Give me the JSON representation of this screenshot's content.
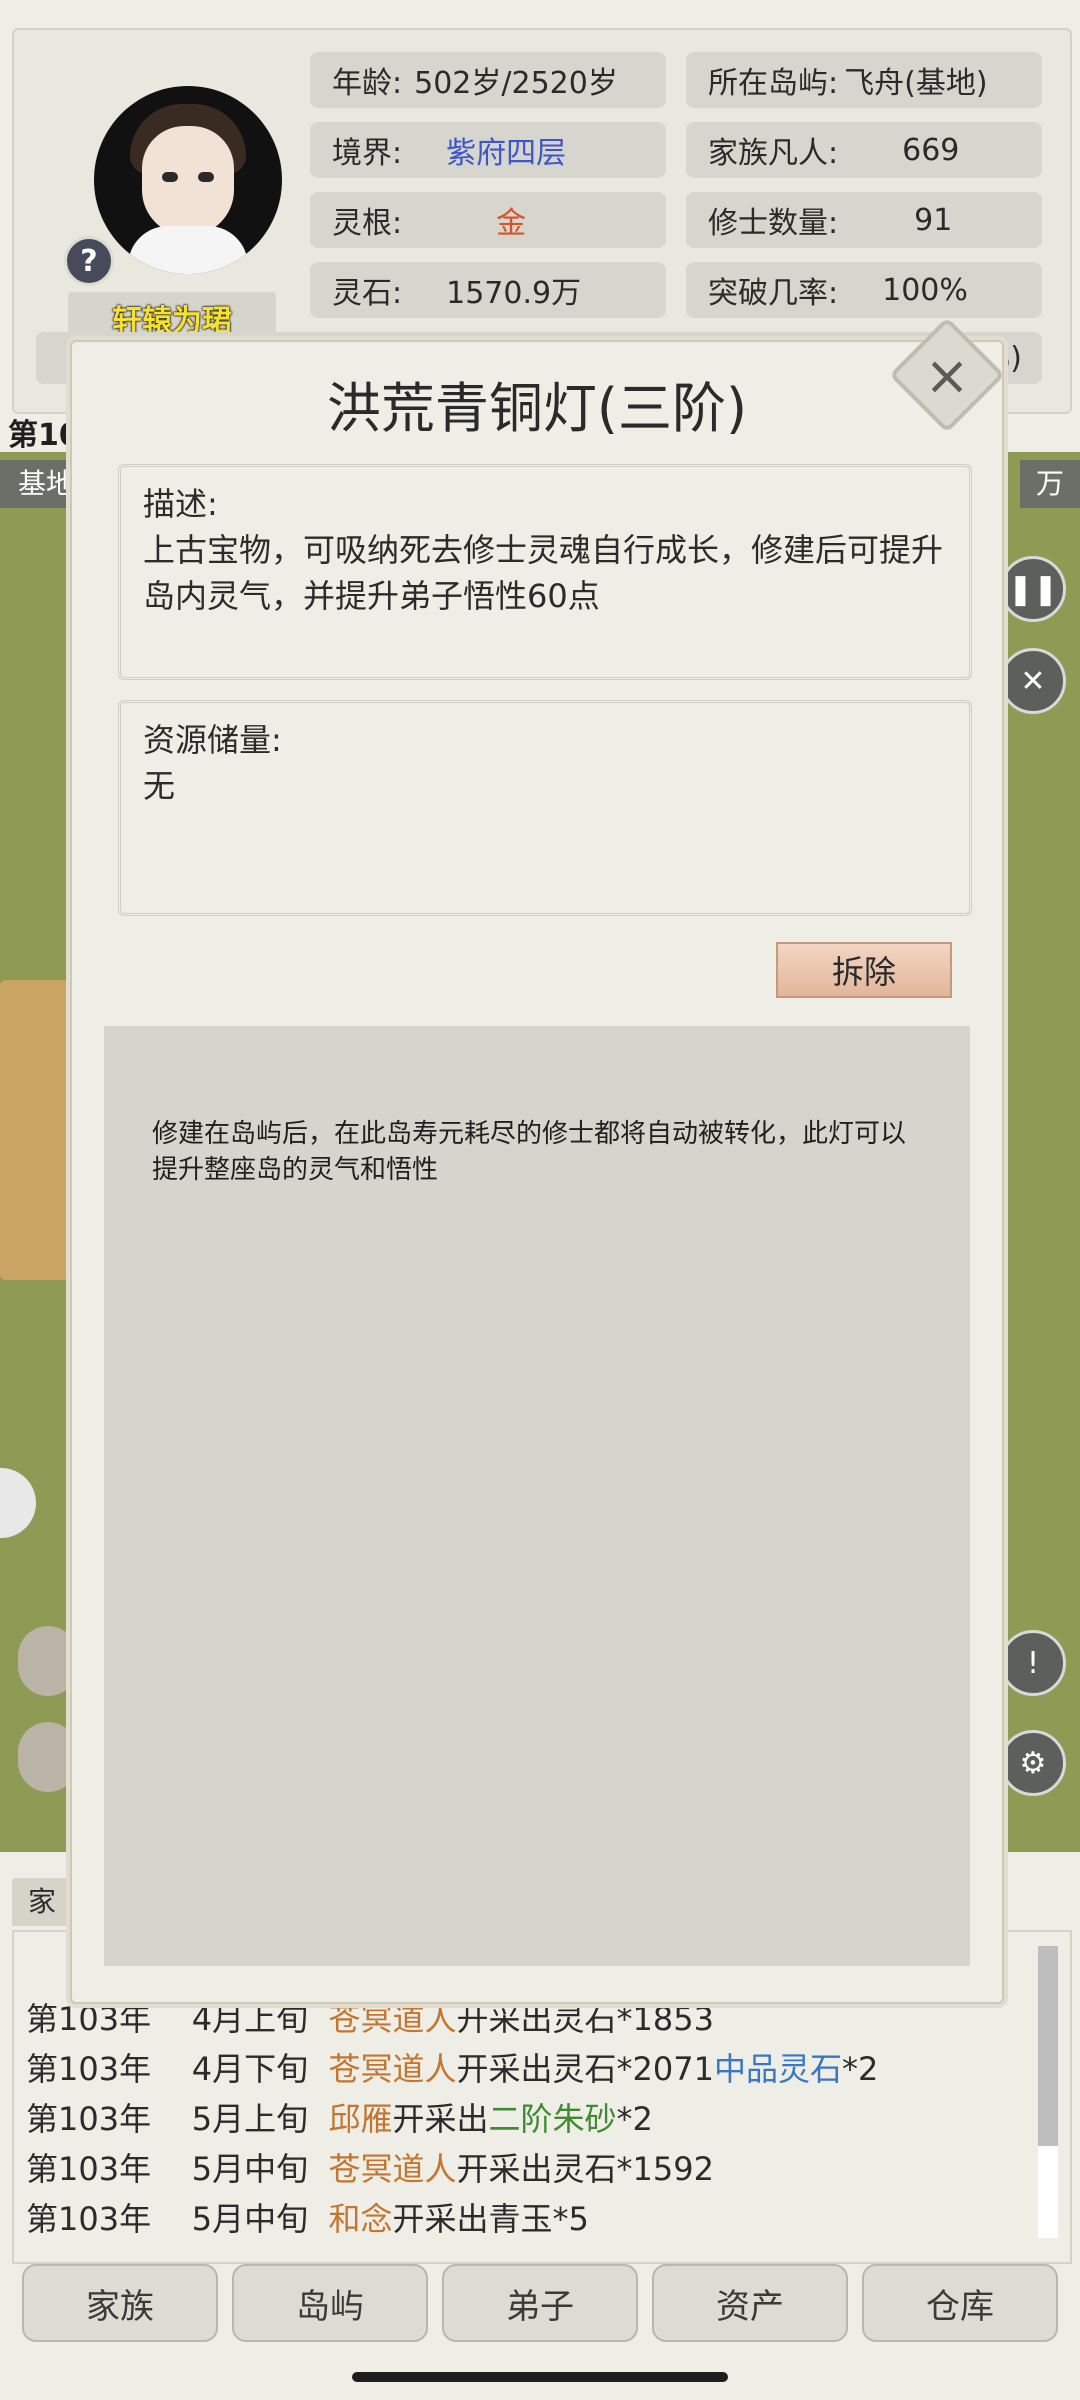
{
  "header": {
    "character_name": "轩辕为珺",
    "stats": {
      "age_label": "年龄:",
      "age_value": "502岁/2520岁",
      "realm_label": "境界:",
      "realm_value": "紫府四层",
      "root_label": "灵根:",
      "root_value": "金",
      "stones_label": "灵石:",
      "stones_value": "1570.9万",
      "island_label": "所在岛屿:",
      "island_value": "飞舟(基地)",
      "mortals_label": "家族凡人:",
      "mortals_value": "669",
      "cultivators_label": "修士数量:",
      "cultivators_value": "91",
      "breakthrough_label": "突破几率:",
      "breakthrough_value": "100%"
    },
    "partial_percent": "%)"
  },
  "map": {
    "year_fragment": "第10",
    "base_label": "基地",
    "wan_label": "万"
  },
  "modal": {
    "title": "洪荒青铜灯(三阶)",
    "description_label": "描述:",
    "description_text": "上古宝物，可吸纳死去修士灵魂自行成长，修建后可提升岛内灵气，并提升弟子悟性60点",
    "resources_label": "资源储量:",
    "resources_value": "无",
    "dismantle_label": "拆除",
    "info_text": "修建在岛屿后，在此岛寿元耗尽的修士都将自动被转化，此灯可以提升整座岛的灵气和悟性"
  },
  "log": {
    "tab_label": "家",
    "entries": [
      {
        "year": "第103年",
        "period": "4月上旬",
        "actor": "苍冥道人",
        "text": "开采出灵石*1853",
        "item": "",
        "item_count": ""
      },
      {
        "year": "第103年",
        "period": "4月下旬",
        "actor": "苍冥道人",
        "text": "开采出灵石*2071",
        "item": "中品灵石",
        "item_count": "*2"
      },
      {
        "year": "第103年",
        "period": "5月上旬",
        "actor": "邱雁",
        "text": "开采出",
        "item": "二阶朱砂",
        "item_count": "*2"
      },
      {
        "year": "第103年",
        "period": "5月中旬",
        "actor": "苍冥道人",
        "text": "开采出灵石*1592",
        "item": "",
        "item_count": ""
      },
      {
        "year": "第103年",
        "period": "5月中旬",
        "actor": "和念",
        "text": "开采出青玉*5",
        "item": "",
        "item_count": ""
      }
    ]
  },
  "nav": [
    "家族",
    "岛屿",
    "弟子",
    "资产",
    "仓库"
  ],
  "colors": {
    "realm": "#3f56c8",
    "root": "#d4542b",
    "actor": "#c2762f",
    "item_blue": "#3a77c3",
    "item_green": "#3f8a33"
  }
}
